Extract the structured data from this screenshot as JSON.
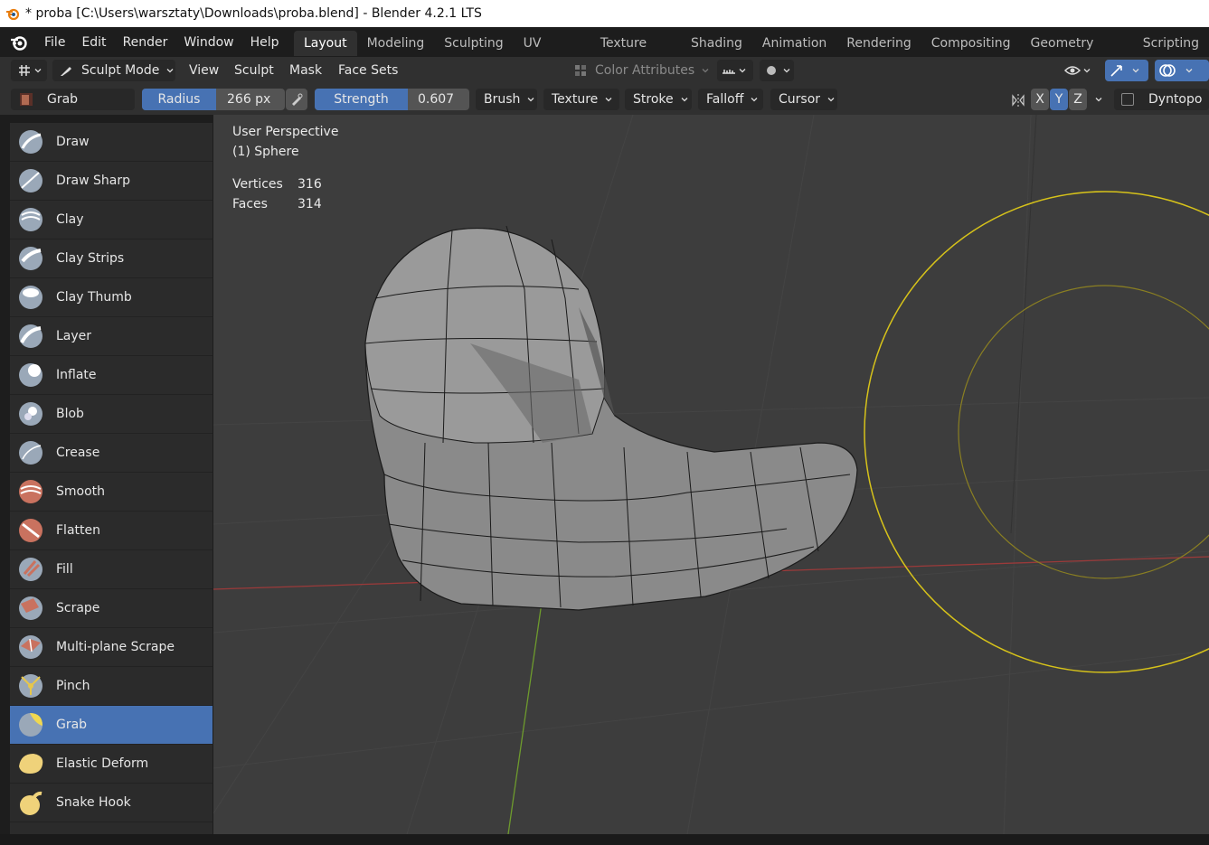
{
  "window": {
    "title": "* proba [C:\\Users\\warsztaty\\Downloads\\proba.blend] - Blender 4.2.1 LTS"
  },
  "menu": [
    "File",
    "Edit",
    "Render",
    "Window",
    "Help"
  ],
  "workspace_tabs": [
    {
      "label": "Layout",
      "active": true
    },
    {
      "label": "Modeling",
      "active": false
    },
    {
      "label": "Sculpting",
      "active": false
    },
    {
      "label": "UV Editing",
      "active": false
    },
    {
      "label": "Texture Paint",
      "active": false
    },
    {
      "label": "Shading",
      "active": false
    },
    {
      "label": "Animation",
      "active": false
    },
    {
      "label": "Rendering",
      "active": false
    },
    {
      "label": "Compositing",
      "active": false
    },
    {
      "label": "Geometry Nodes",
      "active": false
    },
    {
      "label": "Scripting",
      "active": false
    }
  ],
  "header": {
    "mode_label": "Sculpt Mode",
    "menus": [
      "View",
      "Sculpt",
      "Mask",
      "Face Sets"
    ],
    "color_attributes_label": "Color Attributes"
  },
  "tool_header": {
    "brush_name": "Grab",
    "radius_label": "Radius",
    "radius_value": "266 px",
    "strength_label": "Strength",
    "strength_value": "0.607",
    "dropdowns": [
      "Brush",
      "Texture",
      "Stroke",
      "Falloff",
      "Cursor"
    ],
    "axes": [
      "X",
      "Y",
      "Z"
    ],
    "active_axis": "Y",
    "dyntopo_label": "Dyntopo"
  },
  "viewport": {
    "view_name": "User Perspective",
    "object_name": "(1) Sphere",
    "stats": [
      {
        "label": "Vertices",
        "value": "316"
      },
      {
        "label": "Faces",
        "value": "314"
      }
    ]
  },
  "tools": [
    {
      "label": "Draw",
      "icon": "draw-brush-icon",
      "active": false
    },
    {
      "label": "Draw Sharp",
      "icon": "draw-sharp-brush-icon",
      "active": false
    },
    {
      "label": "Clay",
      "icon": "clay-brush-icon",
      "active": false
    },
    {
      "label": "Clay Strips",
      "icon": "clay-strips-brush-icon",
      "active": false
    },
    {
      "label": "Clay Thumb",
      "icon": "clay-thumb-brush-icon",
      "active": false
    },
    {
      "label": "Layer",
      "icon": "layer-brush-icon",
      "active": false
    },
    {
      "label": "Inflate",
      "icon": "inflate-brush-icon",
      "active": false
    },
    {
      "label": "Blob",
      "icon": "blob-brush-icon",
      "active": false
    },
    {
      "label": "Crease",
      "icon": "crease-brush-icon",
      "active": false
    },
    {
      "label": "Smooth",
      "icon": "smooth-brush-icon",
      "active": false
    },
    {
      "label": "Flatten",
      "icon": "flatten-brush-icon",
      "active": false
    },
    {
      "label": "Fill",
      "icon": "fill-brush-icon",
      "active": false
    },
    {
      "label": "Scrape",
      "icon": "scrape-brush-icon",
      "active": false
    },
    {
      "label": "Multi-plane Scrape",
      "icon": "multiplane-scrape-brush-icon",
      "active": false
    },
    {
      "label": "Pinch",
      "icon": "pinch-brush-icon",
      "active": false
    },
    {
      "label": "Grab",
      "icon": "grab-brush-icon",
      "active": true
    },
    {
      "label": "Elastic Deform",
      "icon": "elastic-deform-brush-icon",
      "active": false
    },
    {
      "label": "Snake Hook",
      "icon": "snake-hook-brush-icon",
      "active": false
    }
  ],
  "colors": {
    "accent": "#4772b3",
    "viewport_bg": "#3d3d3d",
    "panel_bg": "#303030",
    "brush_circle": "#e6d21e",
    "x_axis": "#b03c3c",
    "y_axis": "#6e9b2d"
  }
}
